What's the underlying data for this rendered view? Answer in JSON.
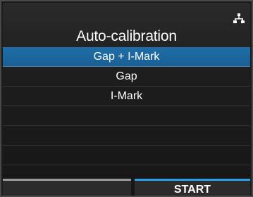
{
  "header": {
    "title": "Auto-calibration",
    "status_icon": "network-icon"
  },
  "menu": {
    "items": [
      {
        "label": "Gap + I-Mark",
        "selected": true
      },
      {
        "label": "Gap",
        "selected": false
      },
      {
        "label": "I-Mark",
        "selected": false
      }
    ]
  },
  "softkeys": {
    "left_label": "",
    "right_label": "START"
  },
  "colors": {
    "selection": "#1f6ea8",
    "accent": "#2aa0e6",
    "background": "#1b1b1b"
  }
}
